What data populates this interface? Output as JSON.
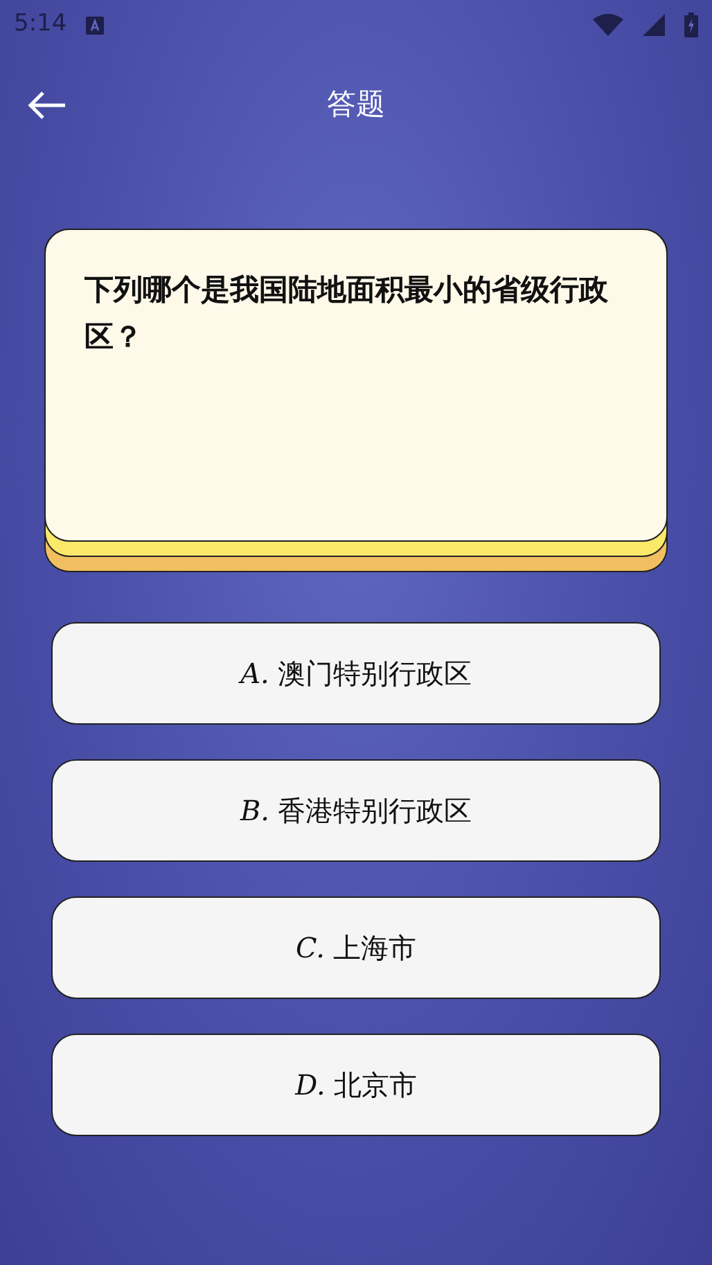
{
  "status_bar": {
    "time": "5:14"
  },
  "app_bar": {
    "title": "答题"
  },
  "question": {
    "text": "下列哪个是我国陆地面积最小的省级行政区？"
  },
  "options": [
    {
      "letter": "A.",
      "text": "澳门特别行政区"
    },
    {
      "letter": "B.",
      "text": "香港特别行政区"
    },
    {
      "letter": "C.",
      "text": "上海市"
    },
    {
      "letter": "D.",
      "text": "北京市"
    }
  ]
}
